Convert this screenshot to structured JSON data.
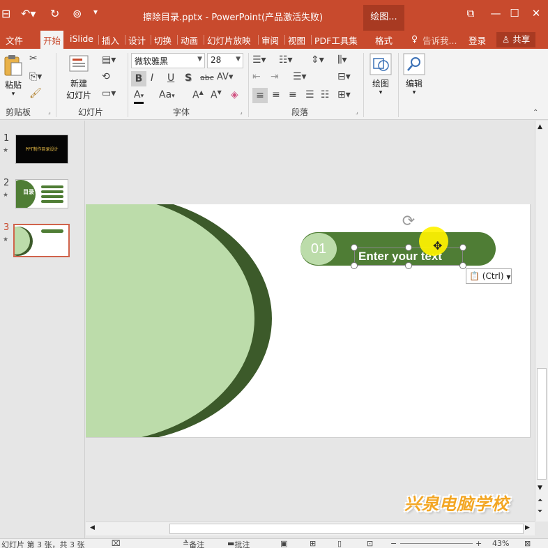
{
  "titlebar": {
    "title": "擦除目录.pptx - PowerPoint(产品激活失败)",
    "context_tab": "绘图...",
    "bg_color": "#c84a2d"
  },
  "tabs": [
    {
      "label": "文件"
    },
    {
      "label": "开始",
      "active": true
    },
    {
      "label": "iSlide"
    },
    {
      "label": "插入"
    },
    {
      "label": "设计"
    },
    {
      "label": "切换"
    },
    {
      "label": "动画"
    },
    {
      "label": "幻灯片放映"
    },
    {
      "label": "审阅"
    },
    {
      "label": "视图"
    },
    {
      "label": "PDF工具集"
    },
    {
      "label": "格式"
    }
  ],
  "tell_me": "告诉我...",
  "login": "登录",
  "share": "共享",
  "ribbon": {
    "clipboard": {
      "paste": "粘贴",
      "label": "剪贴板"
    },
    "slides": {
      "new_slide_line1": "新建",
      "new_slide_line2": "幻灯片",
      "label": "幻灯片"
    },
    "font": {
      "name": "微软雅黑",
      "size": "28",
      "label": "字体",
      "bold": "B",
      "italic": "I",
      "underline": "U",
      "shadow": "S",
      "strike": "abc",
      "spacing": "AV"
    },
    "paragraph": {
      "label": "段落"
    },
    "drawing": {
      "label": "绘图"
    },
    "editing": {
      "label": "编辑"
    }
  },
  "slides_pane": {
    "items": [
      {
        "number": "1",
        "thumb_text": "PPT制作目录设计"
      },
      {
        "number": "2",
        "thumb_text": "目录"
      },
      {
        "number": "3",
        "selected": true
      }
    ]
  },
  "slide": {
    "badge_number": "01",
    "text": "Enter your text",
    "paste_options": "(Ctrl)",
    "colors": {
      "dark_green": "#3c5a2a",
      "mid_green": "#4f7d35",
      "light_green": "#bcdcaa"
    }
  },
  "statusbar": {
    "slide_info": "幻灯片 第 3 张，共 3 张",
    "notes": "备注",
    "comments": "批注",
    "zoom": "43%"
  },
  "watermark": "兴泉电脑学校"
}
